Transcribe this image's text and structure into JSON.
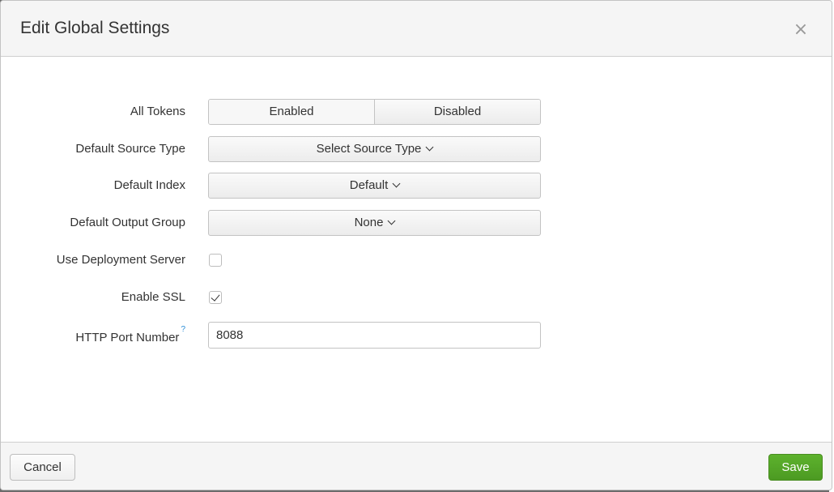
{
  "dialog": {
    "title": "Edit Global Settings",
    "close_glyph": "×"
  },
  "form": {
    "all_tokens": {
      "label": "All Tokens",
      "options": [
        "Enabled",
        "Disabled"
      ],
      "selected": "Enabled"
    },
    "default_source_type": {
      "label": "Default Source Type",
      "value": "Select Source Type"
    },
    "default_index": {
      "label": "Default Index",
      "value": "Default"
    },
    "default_output_group": {
      "label": "Default Output Group",
      "value": "None"
    },
    "use_deployment_server": {
      "label": "Use Deployment Server",
      "checked": false
    },
    "enable_ssl": {
      "label": "Enable SSL",
      "checked": true
    },
    "http_port_number": {
      "label": "HTTP Port Number",
      "help_marker": "?",
      "value": "8088"
    }
  },
  "footer": {
    "cancel_label": "Cancel",
    "save_label": "Save"
  },
  "colors": {
    "save_green": "#5db22d",
    "help_blue": "#2b8dd6"
  },
  "icons": {
    "close": "close-icon",
    "dropdown": "chevron-down-icon",
    "check": "checkmark-icon",
    "help": "help-icon"
  }
}
